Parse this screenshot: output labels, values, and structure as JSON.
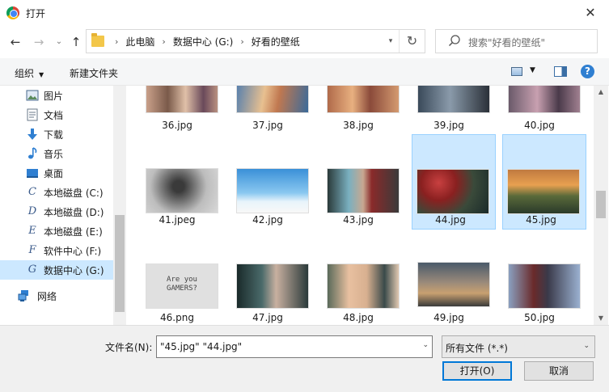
{
  "window": {
    "title": "打开",
    "app_icon": "chrome-icon",
    "close_label": "✕"
  },
  "nav": {
    "back_icon": "←",
    "forward_icon": "→",
    "recent_icon": "⌄",
    "up_icon": "↑",
    "breadcrumbs": [
      "此电脑",
      "数据中心 (G:)",
      "好看的壁纸"
    ],
    "search_placeholder": "搜索\"好看的壁纸\""
  },
  "toolbar": {
    "organize_label": "组织",
    "new_folder_label": "新建文件夹",
    "help_label": "?"
  },
  "sidebar": {
    "items": [
      {
        "label": "图片",
        "icon": "pictures-icon"
      },
      {
        "label": "文档",
        "icon": "documents-icon"
      },
      {
        "label": "下载",
        "icon": "download-icon"
      },
      {
        "label": "音乐",
        "icon": "music-icon"
      },
      {
        "label": "桌面",
        "icon": "desktop-icon"
      },
      {
        "label": "本地磁盘 (C:)",
        "icon": "drive-c-icon",
        "letter": "C"
      },
      {
        "label": "本地磁盘 (D:)",
        "icon": "drive-d-icon",
        "letter": "D"
      },
      {
        "label": "本地磁盘 (E:)",
        "icon": "drive-e-icon",
        "letter": "E"
      },
      {
        "label": "软件中心 (F:)",
        "icon": "drive-f-icon",
        "letter": "F"
      },
      {
        "label": "数据中心 (G:)",
        "icon": "drive-g-icon",
        "letter": "G"
      },
      {
        "label": "网络",
        "icon": "network-icon"
      }
    ]
  },
  "files": [
    {
      "name": "36.jpg"
    },
    {
      "name": "37.jpg"
    },
    {
      "name": "38.jpg"
    },
    {
      "name": "39.jpg"
    },
    {
      "name": "40.jpg"
    },
    {
      "name": "41.jpeg"
    },
    {
      "name": "42.jpg"
    },
    {
      "name": "43.jpg"
    },
    {
      "name": "44.jpg",
      "selected": true
    },
    {
      "name": "45.jpg",
      "selected": true
    },
    {
      "name": "46.png",
      "thumb_text": "Are you\nGAMERS?"
    },
    {
      "name": "47.jpg"
    },
    {
      "name": "48.jpg"
    },
    {
      "name": "49.jpg"
    },
    {
      "name": "50.jpg"
    }
  ],
  "bottom": {
    "filename_label": "文件名(N):",
    "filename_value": "\"45.jpg\" \"44.jpg\"",
    "filter_value": "所有文件 (*.*)",
    "open_button": "打开(O)",
    "cancel_button": "取消"
  }
}
